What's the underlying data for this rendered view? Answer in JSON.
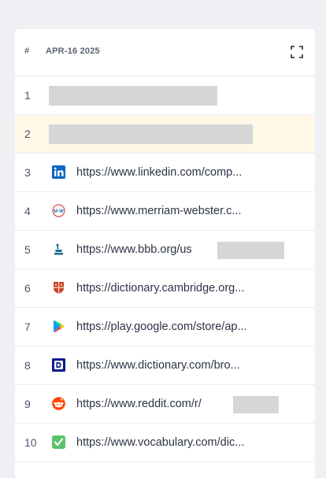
{
  "header": {
    "rank_label": "#",
    "date_label": "APR-16 2025",
    "expand_icon": "expand-icon"
  },
  "rows": [
    {
      "rank": "1",
      "url": "",
      "icon": "",
      "blurred": true
    },
    {
      "rank": "2",
      "url": "",
      "icon": "",
      "blurred": true,
      "highlighted": true
    },
    {
      "rank": "3",
      "url": "https://www.linkedin.com/comp...",
      "icon": "linkedin-icon"
    },
    {
      "rank": "4",
      "url": "https://www.merriam-webster.c...",
      "icon": "merriam-webster-icon"
    },
    {
      "rank": "5",
      "url": "https://www.bbb.org/us",
      "icon": "bbb-icon",
      "redacted": true
    },
    {
      "rank": "6",
      "url": "https://dictionary.cambridge.org...",
      "icon": "cambridge-icon"
    },
    {
      "rank": "7",
      "url": "https://play.google.com/store/ap...",
      "icon": "google-play-icon"
    },
    {
      "rank": "8",
      "url": "https://www.dictionary.com/bro...",
      "icon": "dictionary-com-icon"
    },
    {
      "rank": "9",
      "url": "https://www.reddit.com/r/",
      "icon": "reddit-icon",
      "redacted": true
    },
    {
      "rank": "10",
      "url": "https://www.vocabulary.com/dic...",
      "icon": "vocabulary-icon"
    }
  ],
  "colors": {
    "highlight": "#fff8e6",
    "linkedin": "#0a66c2",
    "reddit": "#ff4500",
    "vocabulary": "#5cc26b",
    "dictionary_com": "#0d1b8c"
  }
}
